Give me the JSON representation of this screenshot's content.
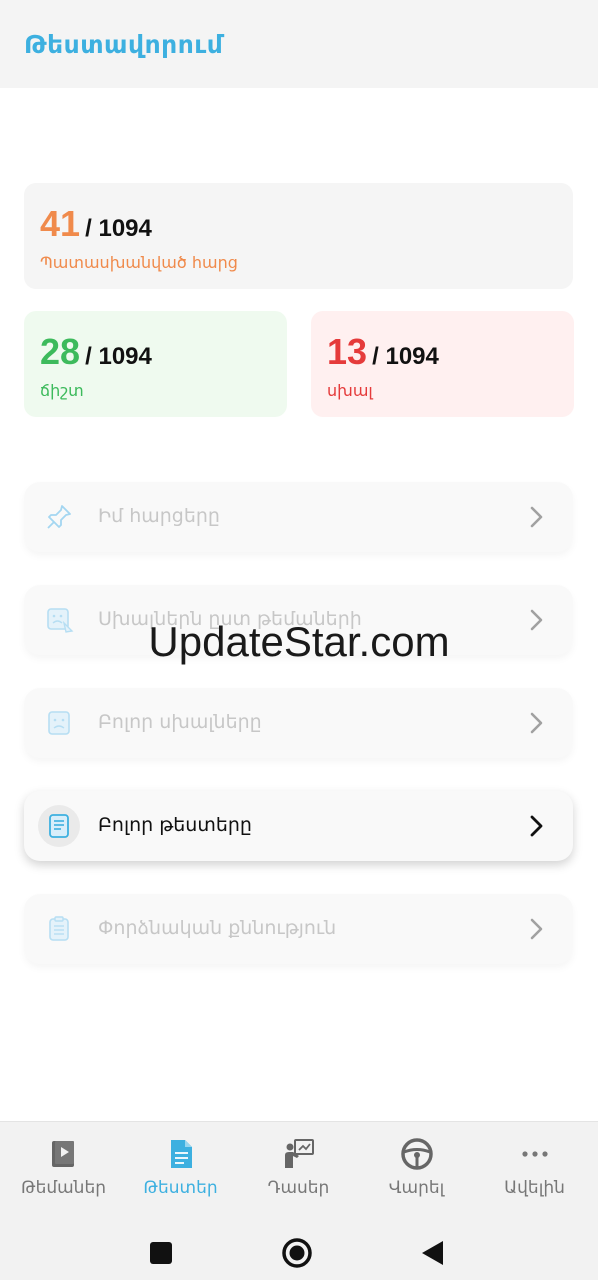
{
  "header": {
    "title": "Թեստավորում"
  },
  "stats": {
    "total": {
      "value": "41",
      "of": "/ 1094",
      "label": "Պատասխանված հարց",
      "color": "#f08a4b"
    },
    "correct": {
      "value": "28",
      "of": "/ 1094",
      "label": "ճիշտ",
      "color": "#3dba5c"
    },
    "wrong": {
      "value": "13",
      "of": "/ 1094",
      "label": "սխալ",
      "color": "#e53b3b"
    }
  },
  "menu": [
    {
      "label": "Իմ հարցերը",
      "icon": "pin-icon",
      "enabled": false
    },
    {
      "label": "Սխալներն ըստ թեմաների",
      "icon": "sad-note-icon",
      "enabled": false
    },
    {
      "label": "Բոլոր սխալները",
      "icon": "sad-face-icon",
      "enabled": false
    },
    {
      "label": "Բոլոր թեստերը",
      "icon": "test-list-icon",
      "enabled": true
    },
    {
      "label": "Փորձնական քննություն",
      "icon": "clipboard-icon",
      "enabled": false
    }
  ],
  "watermark": "UpdateStar.com",
  "bottom_nav": [
    {
      "label": "Թեմաներ",
      "icon": "video-book-icon",
      "active": false
    },
    {
      "label": "Թեստեր",
      "icon": "document-icon",
      "active": true
    },
    {
      "label": "Դասեր",
      "icon": "teacher-board-icon",
      "active": false
    },
    {
      "label": "Վարել",
      "icon": "steering-wheel-icon",
      "active": false
    },
    {
      "label": "Ավելին",
      "icon": "more-dots-icon",
      "active": false
    }
  ],
  "colors": {
    "accent": "#3db0e0"
  }
}
